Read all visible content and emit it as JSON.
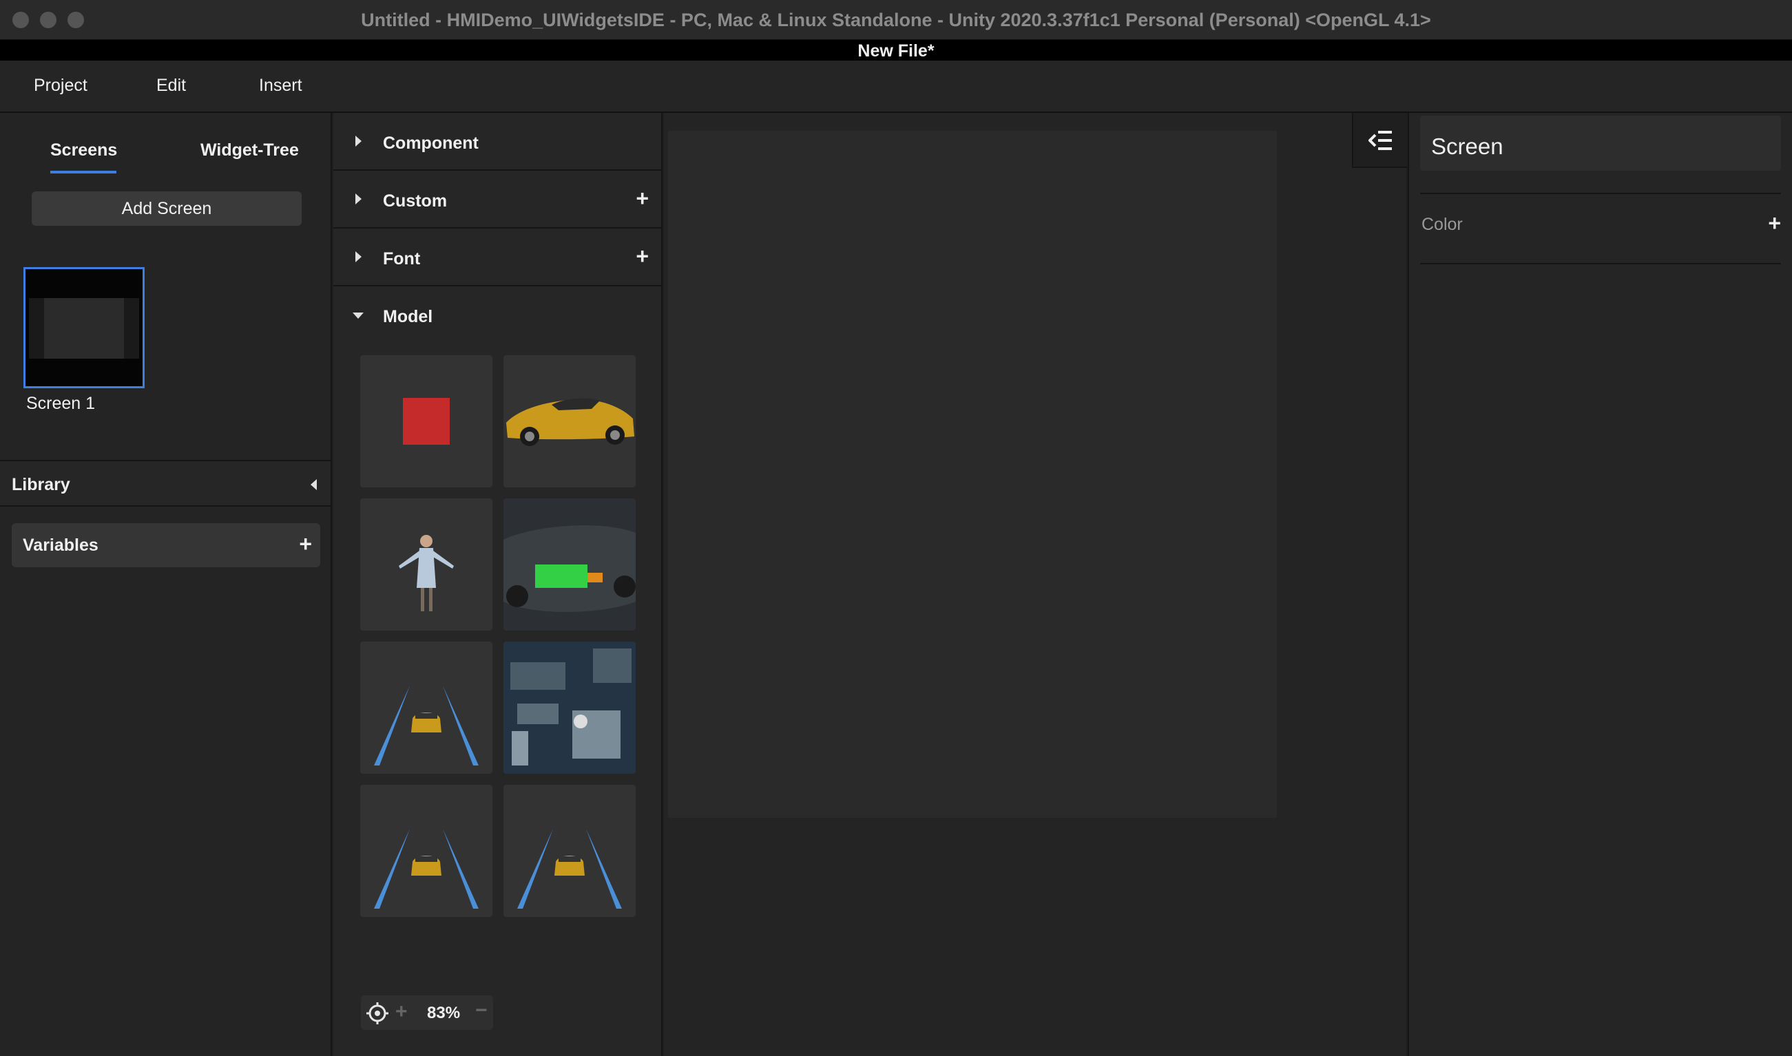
{
  "window": {
    "title": "Untitled - HMIDemo_UIWidgetsIDE - PC, Mac & Linux Standalone - Unity 2020.3.37f1c1 Personal (Personal) <OpenGL 4.1>",
    "document_title": "New File*"
  },
  "menu": {
    "project": "Project",
    "edit": "Edit",
    "insert": "Insert"
  },
  "left_panel": {
    "tabs": [
      {
        "label": "Screens",
        "active": true
      },
      {
        "label": "Widget-Tree",
        "active": false
      }
    ],
    "add_screen_label": "Add Screen",
    "screens": [
      {
        "label": "Screen 1",
        "selected": true
      }
    ],
    "library_label": "Library",
    "variables_label": "Variables"
  },
  "asset_panel": {
    "sections": [
      {
        "label": "Component",
        "expanded": false,
        "has_add": false
      },
      {
        "label": "Custom",
        "expanded": false,
        "has_add": true
      },
      {
        "label": "Font",
        "expanded": false,
        "has_add": true
      },
      {
        "label": "Model",
        "expanded": true,
        "has_add": false
      }
    ],
    "models": [
      {
        "icon": "red-cube-model"
      },
      {
        "icon": "sports-car-model"
      },
      {
        "icon": "character-model"
      },
      {
        "icon": "ev-chassis-battery-model"
      },
      {
        "icon": "car-lane-lines-model"
      },
      {
        "icon": "city-map-model"
      },
      {
        "icon": "car-lane-lines-model"
      },
      {
        "icon": "car-lane-lines-model"
      }
    ],
    "zoom": "83%"
  },
  "inspector": {
    "title": "Screen",
    "color_label": "Color"
  },
  "colors": {
    "accent": "#3d7fe0",
    "background": "#1e1e1e",
    "panel": "#262626"
  }
}
